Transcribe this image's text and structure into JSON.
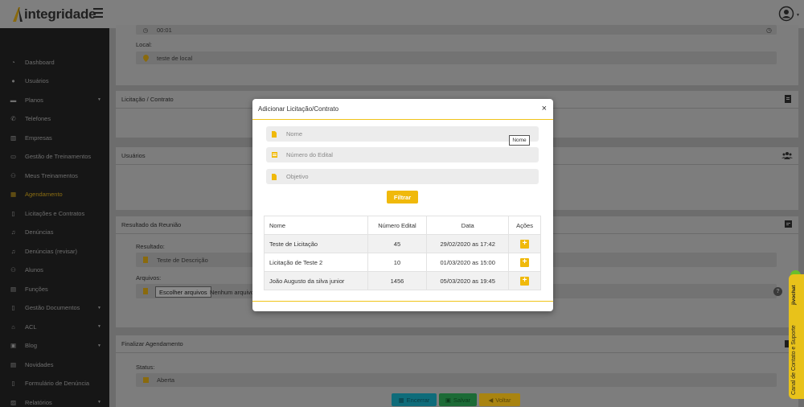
{
  "header": {
    "brand": "integridade"
  },
  "sidebar": {
    "items": [
      {
        "label": "Dashboard",
        "icon": "dashboard-icon"
      },
      {
        "label": "Usuários",
        "icon": "user-icon"
      },
      {
        "label": "Planos",
        "icon": "briefcase-icon",
        "caret": "▼"
      },
      {
        "label": "Telefones",
        "icon": "phone-icon"
      },
      {
        "label": "Empresas",
        "icon": "building-icon"
      },
      {
        "label": "Gestão de Treinamentos",
        "icon": "presentation-icon"
      },
      {
        "label": "Meus Treinamentos",
        "icon": "users-icon"
      },
      {
        "label": "Agendamento",
        "icon": "calendar-icon"
      },
      {
        "label": "Licitações e Contratos",
        "icon": "file-icon"
      },
      {
        "label": "Denúncias",
        "icon": "microphone-icon"
      },
      {
        "label": "Denúncias (revisar)",
        "icon": "microphone-icon"
      },
      {
        "label": "Alunos",
        "icon": "users-icon"
      },
      {
        "label": "Funções",
        "icon": "id-card-icon"
      },
      {
        "label": "Gestão Documentos",
        "icon": "file-icon",
        "caret": "▼"
      },
      {
        "label": "ACL",
        "icon": "bank-icon",
        "caret": "▼"
      },
      {
        "label": "Blog",
        "icon": "blog-icon",
        "caret": "▼"
      },
      {
        "label": "Novidades",
        "icon": "news-icon"
      },
      {
        "label": "Formulário de Denúncia",
        "icon": "form-icon"
      },
      {
        "label": "Relatórios",
        "icon": "report-icon",
        "caret": "▼"
      }
    ],
    "active_index": 7
  },
  "content": {
    "time_value": "00:01",
    "local_label": "Local:",
    "local_value": "teste de local",
    "licitacao_header": "Licitação / Contrato",
    "usuarios_header": "Usuários",
    "resultado_header": "Resultado da Reunião",
    "resultado_label": "Resultado:",
    "resultado_value": "Teste de Descrição",
    "arquivos_label": "Arquivos:",
    "file_button": "Escolher arquivos",
    "file_status": "Nenhum arquivo",
    "help_glyph": "?",
    "finalizar_header": "Finalizar Agendamento",
    "status_label": "Status:",
    "status_value": "Aberta",
    "buttons": {
      "encerrar": "Encerrar",
      "salvar": "Salvar",
      "voltar": "Voltar"
    }
  },
  "modal": {
    "title": "Adicionar Licitação/Contrato",
    "close": "×",
    "inputs": [
      {
        "placeholder": "Nome"
      },
      {
        "placeholder": "Número do Edital"
      },
      {
        "placeholder": "Objetivo"
      }
    ],
    "tooltip": "Nome",
    "filter_button": "Filtrar",
    "table": {
      "headers": [
        "Nome",
        "Número Edital",
        "Data",
        "Ações"
      ],
      "rows": [
        {
          "nome": "Teste de Licitação",
          "numero": "45",
          "data": "29/02/2020 as 17:42"
        },
        {
          "nome": "Licitação de Teste 2",
          "numero": "10",
          "data": "01/03/2020 as 15:00"
        },
        {
          "nome": "João Augusto da silva junior",
          "numero": "1456",
          "data": "05/03/2020 as 19:45"
        }
      ],
      "action_glyph": "+"
    }
  },
  "jivo": {
    "brand": "jivochat",
    "label": "Canal de Contato e Suporte"
  },
  "colors": {
    "accent": "#f0b90b",
    "sidebar_bg": "#161616",
    "overlay_bg": "#6d6d6d",
    "encerrar": "#0f6c7a",
    "salvar": "#1c6b36",
    "voltar": "#a98410"
  }
}
